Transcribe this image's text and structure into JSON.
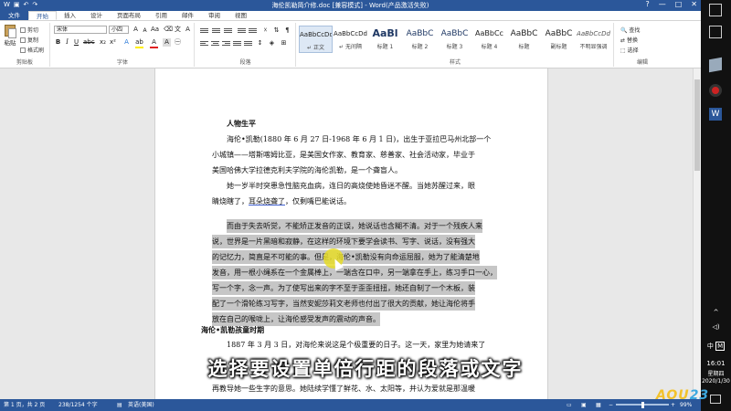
{
  "window": {
    "title": "海伦凯勒简介修.doc [兼容模式] - Word(产品激活失败)",
    "controls": {
      "help": "?",
      "minimize": "—",
      "restore": "□",
      "close": "✕"
    }
  },
  "ribbon_tabs": [
    "文件",
    "开始",
    "插入",
    "设计",
    "页面布局",
    "引用",
    "邮件",
    "审阅",
    "视图"
  ],
  "clipboard": {
    "paste": "粘贴",
    "cut": "剪切",
    "copy": "复制",
    "format_painter": "格式刷",
    "label": "剪贴板"
  },
  "font": {
    "name": "宋体",
    "size": "小四",
    "label": "字体"
  },
  "paragraph": {
    "label": "段落"
  },
  "styles": {
    "items": [
      {
        "preview": "AaBbCcDd",
        "name": "↵ 正文"
      },
      {
        "preview": "AaBbCcDd",
        "name": "↵ 无间隔"
      },
      {
        "preview": "AaBl",
        "name": "标题 1"
      },
      {
        "preview": "AaBbC",
        "name": "标题 2"
      },
      {
        "preview": "AaBbC",
        "name": "标题 3"
      },
      {
        "preview": "AaBbCc",
        "name": "标题 4"
      },
      {
        "preview": "AaBbC",
        "name": "标题"
      },
      {
        "preview": "AaBbC",
        "name": "副标题"
      },
      {
        "preview": "AaBbCcDd",
        "name": "不明显强调"
      }
    ],
    "label": "样式"
  },
  "editing": {
    "find": "查找",
    "replace": "替换",
    "select": "选择",
    "label": "编辑"
  },
  "document": {
    "heading1": "人物生平",
    "p1_l1": "海伦•凯勒(1880 年 6 月 27 日-1968 年 6 月 1 日)，出生于亚拉巴马州北部一个",
    "p1_l2": "小城镇——塔斯喀姆比亚，是美国女作家、教育家、慈善家、社会活动家，毕业于",
    "p1_l3": "美国哈佛大学拉德克利夫学院的海伦凯勒，是一个聋盲人。",
    "p2_l1": "她一岁半时突患急性脑充血病，连日的高烧使她昏迷不醒。当她苏醒过来，眼",
    "p2_l2a": "睛烧瞎了，",
    "p2_l2b": "耳朵烧聋了",
    "p2_l2c": "，仅剩嘴巴能说话。",
    "p3_l1": "而由于失去听觉，不能矫正发音的正误，她说话也含糊不清。对于一个残疾人来",
    "p3_l2": "说，世界是一片黑暗和寂静，在这样的环境下要学会读书、写字、说话，没有强大",
    "p3_l3": "的记忆力，简直是不可能的事。但是，海伦•凯勒没有向命运屈服，她为了能清楚地",
    "p3_l4": "发音，用一根小绳系在一个金属棒上，一端含在口中，另一端拿在手上，练习手口一心，",
    "p3_l5": "写一个字，念一声。为了使写出来的字不至于歪歪扭扭，她还自制了一个木板，装",
    "p3_l6": "配了一个滑轮练习写字，当然安妮莎莉文老师也付出了很大的贡献，她让海伦将手",
    "p3_l7": "放在自己的喉咙上，让海伦感受发声的震动的声音。",
    "heading2": "海伦•凯勒孩童时期",
    "p4_l1": "1887 年 3 月 3 日，对海伦来说这是个极重要的日子。这一天，家里为她请来了",
    "p4_l2": "再教导她一些生字的意思。她陆续学懂了鲜花、水、太阳等，并认为爱就是那温暖"
  },
  "subtitle": "选择要设置单倍行距的段落或文字",
  "status": {
    "page": "第 1 页，共 2 页",
    "words": "238/1254 个字",
    "language": "英语(美国)",
    "zoom": "99%"
  },
  "taskbar": {
    "ime": "中",
    "time": "16:01",
    "weekday": "星期四",
    "date": "2020/1/30"
  },
  "watermark": "AOU23"
}
